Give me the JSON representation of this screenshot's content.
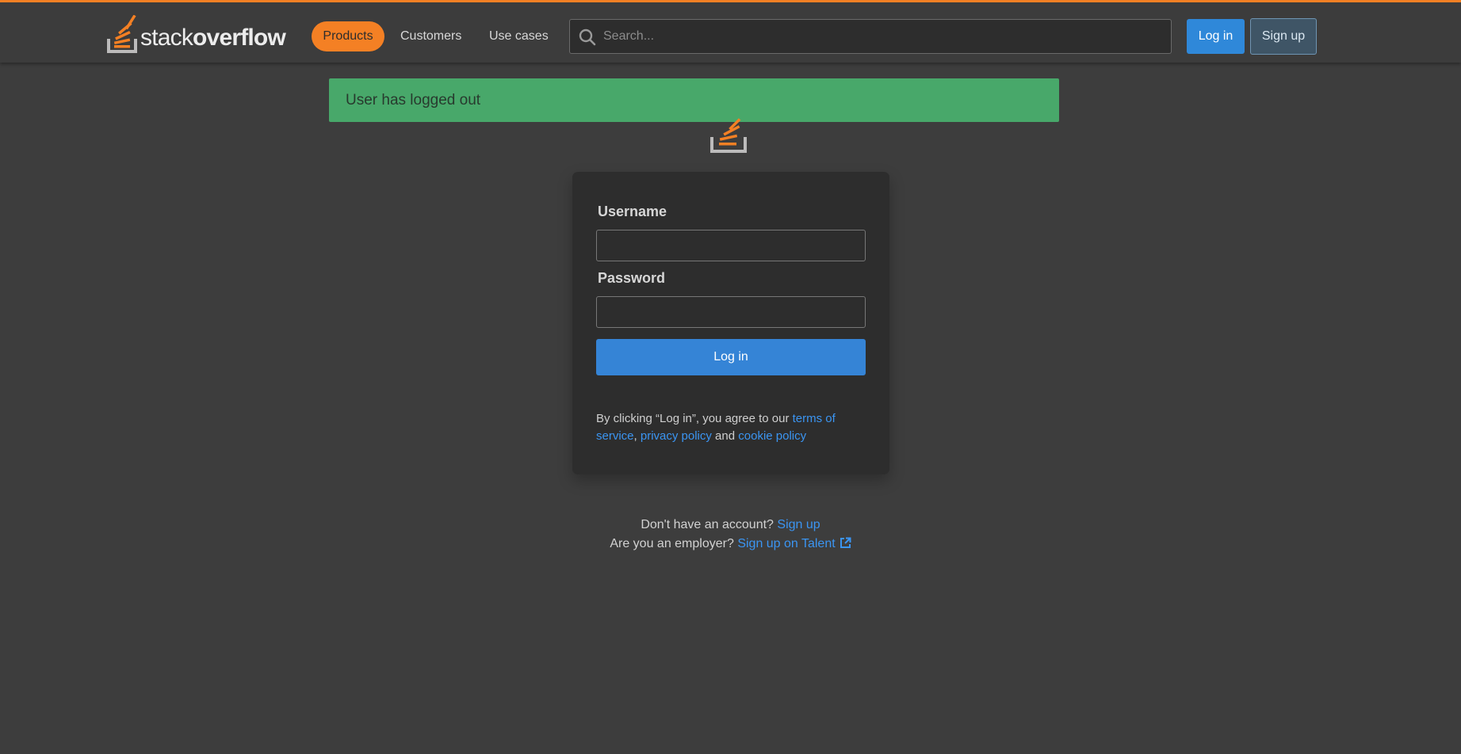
{
  "header": {
    "logo_light": "stack",
    "logo_bold": "overflow",
    "nav": {
      "products": "Products",
      "customers": "Customers",
      "use_cases": "Use cases"
    },
    "search": {
      "placeholder": "Search..."
    },
    "login_label": "Log in",
    "signup_label": "Sign up"
  },
  "flash": {
    "message": "User has logged out"
  },
  "login_form": {
    "username_label": "Username",
    "password_label": "Password",
    "username_value": "",
    "password_value": "",
    "submit_label": "Log in",
    "legal": {
      "prefix": "By clicking “Log in”, you agree to our ",
      "terms_link": "terms of service",
      "comma": ",",
      "privacy_link": "privacy policy",
      "and": " and ",
      "cookie_link": "cookie policy"
    }
  },
  "footer": {
    "no_account_text": "Don't have an account? ",
    "signup_link": "Sign up",
    "employer_text": "Are you an employer? ",
    "talent_link": "Sign up on Talent"
  },
  "colors": {
    "accent": "#f48024",
    "primary": "#3584d6",
    "link": "#3b95f2",
    "success": "#48a86a",
    "background": "#3d3d3d",
    "card": "#2d2d2d"
  },
  "icons": {
    "logo": "stackoverflow-logo-icon",
    "search": "search-icon",
    "external": "external-link-icon"
  }
}
